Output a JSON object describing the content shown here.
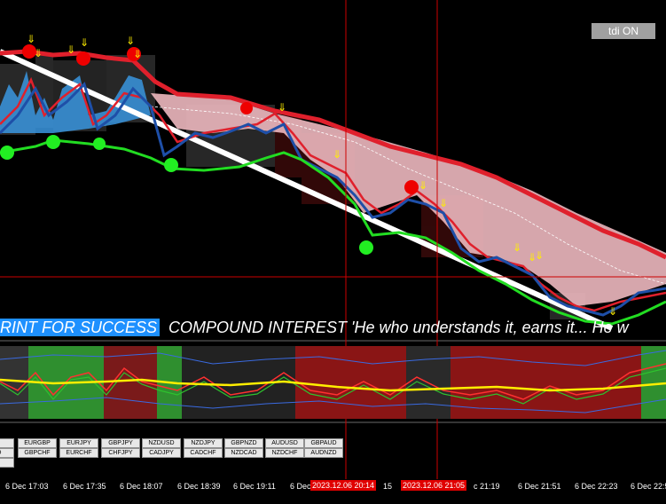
{
  "toolbar": {
    "tdi_label": "tdi ON"
  },
  "ticker": {
    "highlight": "RINT FOR SUCCESS",
    "text": "COMPOUND INTEREST 'He who understands it, earns it... He w"
  },
  "pairs": [
    [
      "",
      "EURGBP",
      "EURJPY",
      "GBPJPY",
      "NZDUSD",
      "NZDJPY",
      "GBPNZD",
      "AUDUSD",
      "GBPAUD"
    ],
    [
      "CAD",
      "GBPCHF",
      "EURCHF",
      "CHFJPY",
      "CADJPY",
      "CADCHF",
      "NZDCAD",
      "NZDCHF",
      "AUDNZD"
    ],
    [
      "ZD"
    ]
  ],
  "time_axis": {
    "labels": [
      "6 Dec 17:03",
      "6 Dec 17:35",
      "6 Dec 18:07",
      "6 Dec 18:39",
      "6 Dec 19:11",
      "6 Dec",
      "15",
      "c 21:19",
      "6 Dec 21:51",
      "6 Dec 22:23",
      "6 Dec 22:55"
    ],
    "markers": [
      "2023.12.06 20:14",
      "2023.12.06 21:05"
    ]
  },
  "colors": {
    "background": "#000000",
    "upper_band": "#e0202c",
    "lower_band": "#22dd22",
    "price_line": "#1e4fa8",
    "cloud_bear": "#e8b4bb",
    "cloud_bull": "#3a96e0",
    "trendline": "#ffffff",
    "signal_arrow": "#ffee00",
    "rsi_line": "#ffee00",
    "vertical_line": "#cc0000"
  }
}
